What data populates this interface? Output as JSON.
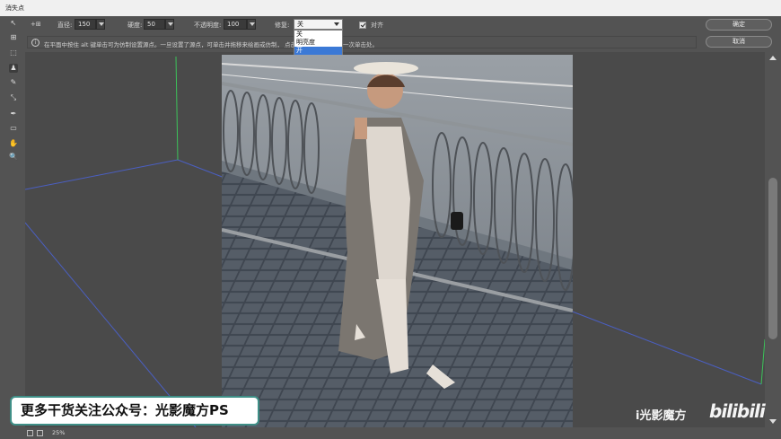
{
  "window": {
    "title": "消失点"
  },
  "options": {
    "mode_icon": "+⊞",
    "diameter_label": "直径:",
    "diameter_value": "150",
    "hardness_label": "硬度:",
    "hardness_value": "50",
    "opacity_label": "不透明度:",
    "opacity_value": "100",
    "repair_label": "修复:",
    "repair_value": "关",
    "repair_options": [
      "关",
      "明亮度",
      "开"
    ],
    "align_label": "对齐"
  },
  "buttons": {
    "ok": "确定",
    "cancel": "取消"
  },
  "info": {
    "icon": "i",
    "text": "在平面中按住 alt 键单击可为仿制设置源点。一旦设置了源点，可单击并拖移来绘画或仿制，                          点击可将描边扩展到上一次单击处。"
  },
  "tools": [
    "edit-plane-icon",
    "create-plane-icon",
    "marquee-icon",
    "stamp-icon",
    "brush-icon",
    "transform-icon",
    "eyedropper-icon",
    "measure-icon",
    "hand-icon",
    "zoom-icon"
  ],
  "tool_glyphs": [
    "↖",
    "⊞",
    "⬚",
    "♟",
    "✎",
    "⤡",
    "✒",
    "▭",
    "✋",
    "🔍"
  ],
  "status": {
    "zoom": "25%"
  },
  "overlay": {
    "caption": "更多干货关注公众号：光影魔方PS",
    "brand": "i光影魔方",
    "logo": "bilibili"
  },
  "colors": {
    "plane_blue": "#4a5fc2",
    "plane_green": "#3cc45a",
    "caption_border": "#3f8f87"
  }
}
